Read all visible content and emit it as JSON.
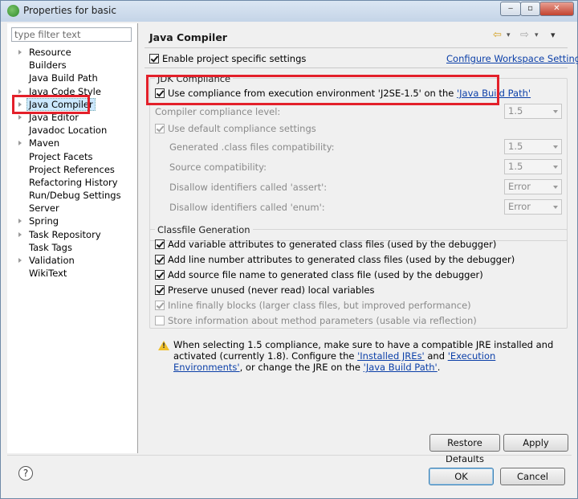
{
  "window": {
    "title": "Properties for basic",
    "min": "‒",
    "max": "▫",
    "close": "✕"
  },
  "sidebar": {
    "filter_placeholder": "type filter text",
    "items": [
      {
        "label": "Resource",
        "expandable": true
      },
      {
        "label": "Builders",
        "expandable": false
      },
      {
        "label": "Java Build Path",
        "expandable": false
      },
      {
        "label": "Java Code Style",
        "expandable": true
      },
      {
        "label": "Java Compiler",
        "expandable": true,
        "selected": true
      },
      {
        "label": "Java Editor",
        "expandable": true
      },
      {
        "label": "Javadoc Location",
        "expandable": false
      },
      {
        "label": "Maven",
        "expandable": true
      },
      {
        "label": "Project Facets",
        "expandable": false
      },
      {
        "label": "Project References",
        "expandable": false
      },
      {
        "label": "Refactoring History",
        "expandable": false
      },
      {
        "label": "Run/Debug Settings",
        "expandable": false
      },
      {
        "label": "Server",
        "expandable": false
      },
      {
        "label": "Spring",
        "expandable": true
      },
      {
        "label": "Task Repository",
        "expandable": true
      },
      {
        "label": "Task Tags",
        "expandable": false
      },
      {
        "label": "Validation",
        "expandable": true
      },
      {
        "label": "WikiText",
        "expandable": false
      }
    ]
  },
  "page": {
    "title": "Java Compiler",
    "nav": {
      "back": "⇦",
      "forward": "⇨",
      "menu": "▾"
    },
    "enable_project_specific": "Enable project specific settings",
    "configure_link": "Configure Workspace Settings...",
    "jdk_group": {
      "label": "JDK Compliance",
      "use_compliance_prefix": "Use compliance from execution environment 'J2SE-1.5' on the ",
      "use_compliance_link": "'Java Build Path'",
      "compliance_level_label": "Compiler compliance level:",
      "compliance_level_value": "1.5",
      "use_default_label": "Use default compliance settings",
      "generated_label": "Generated .class files compatibility:",
      "generated_value": "1.5",
      "source_label": "Source compatibility:",
      "source_value": "1.5",
      "assert_label": "Disallow identifiers called 'assert':",
      "assert_value": "Error",
      "enum_label": "Disallow identifiers called 'enum':",
      "enum_value": "Error"
    },
    "classfile_group": {
      "label": "Classfile Generation",
      "options": [
        {
          "label": "Add variable attributes to generated class files (used by the debugger)",
          "checked": true,
          "enabled": true
        },
        {
          "label": "Add line number attributes to generated class files (used by the debugger)",
          "checked": true,
          "enabled": true
        },
        {
          "label": "Add source file name to generated class file (used by the debugger)",
          "checked": true,
          "enabled": true
        },
        {
          "label": "Preserve unused (never read) local variables",
          "checked": true,
          "enabled": true
        },
        {
          "label": "Inline finally blocks (larger class files, but improved performance)",
          "checked": true,
          "enabled": false
        },
        {
          "label": "Store information about method parameters (usable via reflection)",
          "checked": false,
          "enabled": false
        }
      ]
    },
    "warning": {
      "text_1": "When selecting 1.5 compliance, make sure to have a compatible JRE installed and activated (currently 1.8). Configure the ",
      "link_1": "'Installed JREs'",
      "text_2": " and ",
      "link_2": "'Execution Environments'",
      "text_3": ", or change the JRE on the ",
      "link_3": "'Java Build Path'",
      "text_4": "."
    },
    "restore_defaults": "Restore Defaults",
    "apply": "Apply"
  },
  "footer": {
    "help": "?",
    "ok": "OK",
    "cancel": "Cancel"
  },
  "colors": {
    "highlight": "#e3202a",
    "link": "#0b3fa8"
  }
}
